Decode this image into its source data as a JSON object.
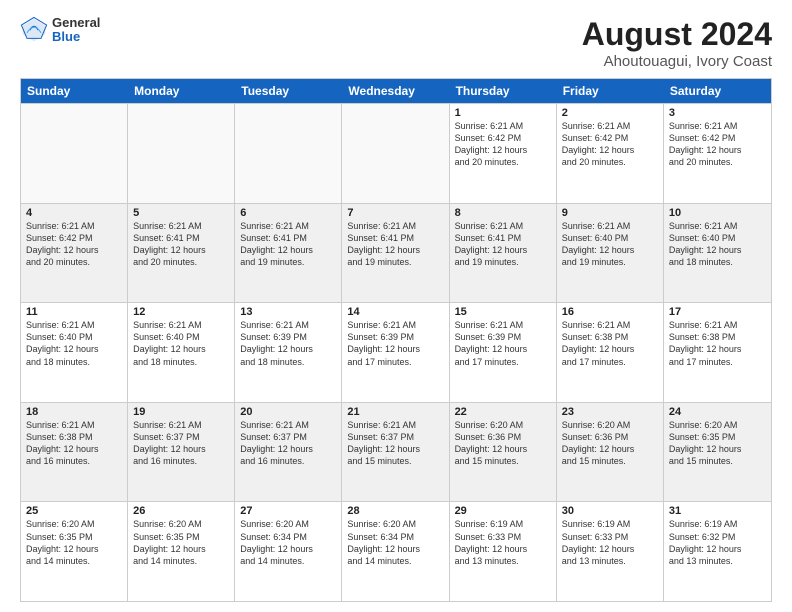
{
  "header": {
    "logo_general": "General",
    "logo_blue": "Blue",
    "title": "August 2024",
    "subtitle": "Ahoutouagui, Ivory Coast"
  },
  "weekdays": [
    "Sunday",
    "Monday",
    "Tuesday",
    "Wednesday",
    "Thursday",
    "Friday",
    "Saturday"
  ],
  "rows": [
    [
      {
        "day": "",
        "info": "",
        "empty": true
      },
      {
        "day": "",
        "info": "",
        "empty": true
      },
      {
        "day": "",
        "info": "",
        "empty": true
      },
      {
        "day": "",
        "info": "",
        "empty": true
      },
      {
        "day": "1",
        "info": "Sunrise: 6:21 AM\nSunset: 6:42 PM\nDaylight: 12 hours\nand 20 minutes."
      },
      {
        "day": "2",
        "info": "Sunrise: 6:21 AM\nSunset: 6:42 PM\nDaylight: 12 hours\nand 20 minutes."
      },
      {
        "day": "3",
        "info": "Sunrise: 6:21 AM\nSunset: 6:42 PM\nDaylight: 12 hours\nand 20 minutes."
      }
    ],
    [
      {
        "day": "4",
        "info": "Sunrise: 6:21 AM\nSunset: 6:42 PM\nDaylight: 12 hours\nand 20 minutes."
      },
      {
        "day": "5",
        "info": "Sunrise: 6:21 AM\nSunset: 6:41 PM\nDaylight: 12 hours\nand 20 minutes."
      },
      {
        "day": "6",
        "info": "Sunrise: 6:21 AM\nSunset: 6:41 PM\nDaylight: 12 hours\nand 19 minutes."
      },
      {
        "day": "7",
        "info": "Sunrise: 6:21 AM\nSunset: 6:41 PM\nDaylight: 12 hours\nand 19 minutes."
      },
      {
        "day": "8",
        "info": "Sunrise: 6:21 AM\nSunset: 6:41 PM\nDaylight: 12 hours\nand 19 minutes."
      },
      {
        "day": "9",
        "info": "Sunrise: 6:21 AM\nSunset: 6:40 PM\nDaylight: 12 hours\nand 19 minutes."
      },
      {
        "day": "10",
        "info": "Sunrise: 6:21 AM\nSunset: 6:40 PM\nDaylight: 12 hours\nand 18 minutes."
      }
    ],
    [
      {
        "day": "11",
        "info": "Sunrise: 6:21 AM\nSunset: 6:40 PM\nDaylight: 12 hours\nand 18 minutes."
      },
      {
        "day": "12",
        "info": "Sunrise: 6:21 AM\nSunset: 6:40 PM\nDaylight: 12 hours\nand 18 minutes."
      },
      {
        "day": "13",
        "info": "Sunrise: 6:21 AM\nSunset: 6:39 PM\nDaylight: 12 hours\nand 18 minutes."
      },
      {
        "day": "14",
        "info": "Sunrise: 6:21 AM\nSunset: 6:39 PM\nDaylight: 12 hours\nand 17 minutes."
      },
      {
        "day": "15",
        "info": "Sunrise: 6:21 AM\nSunset: 6:39 PM\nDaylight: 12 hours\nand 17 minutes."
      },
      {
        "day": "16",
        "info": "Sunrise: 6:21 AM\nSunset: 6:38 PM\nDaylight: 12 hours\nand 17 minutes."
      },
      {
        "day": "17",
        "info": "Sunrise: 6:21 AM\nSunset: 6:38 PM\nDaylight: 12 hours\nand 17 minutes."
      }
    ],
    [
      {
        "day": "18",
        "info": "Sunrise: 6:21 AM\nSunset: 6:38 PM\nDaylight: 12 hours\nand 16 minutes."
      },
      {
        "day": "19",
        "info": "Sunrise: 6:21 AM\nSunset: 6:37 PM\nDaylight: 12 hours\nand 16 minutes."
      },
      {
        "day": "20",
        "info": "Sunrise: 6:21 AM\nSunset: 6:37 PM\nDaylight: 12 hours\nand 16 minutes."
      },
      {
        "day": "21",
        "info": "Sunrise: 6:21 AM\nSunset: 6:37 PM\nDaylight: 12 hours\nand 15 minutes."
      },
      {
        "day": "22",
        "info": "Sunrise: 6:20 AM\nSunset: 6:36 PM\nDaylight: 12 hours\nand 15 minutes."
      },
      {
        "day": "23",
        "info": "Sunrise: 6:20 AM\nSunset: 6:36 PM\nDaylight: 12 hours\nand 15 minutes."
      },
      {
        "day": "24",
        "info": "Sunrise: 6:20 AM\nSunset: 6:35 PM\nDaylight: 12 hours\nand 15 minutes."
      }
    ],
    [
      {
        "day": "25",
        "info": "Sunrise: 6:20 AM\nSunset: 6:35 PM\nDaylight: 12 hours\nand 14 minutes."
      },
      {
        "day": "26",
        "info": "Sunrise: 6:20 AM\nSunset: 6:35 PM\nDaylight: 12 hours\nand 14 minutes."
      },
      {
        "day": "27",
        "info": "Sunrise: 6:20 AM\nSunset: 6:34 PM\nDaylight: 12 hours\nand 14 minutes."
      },
      {
        "day": "28",
        "info": "Sunrise: 6:20 AM\nSunset: 6:34 PM\nDaylight: 12 hours\nand 14 minutes."
      },
      {
        "day": "29",
        "info": "Sunrise: 6:19 AM\nSunset: 6:33 PM\nDaylight: 12 hours\nand 13 minutes."
      },
      {
        "day": "30",
        "info": "Sunrise: 6:19 AM\nSunset: 6:33 PM\nDaylight: 12 hours\nand 13 minutes."
      },
      {
        "day": "31",
        "info": "Sunrise: 6:19 AM\nSunset: 6:32 PM\nDaylight: 12 hours\nand 13 minutes."
      }
    ]
  ]
}
